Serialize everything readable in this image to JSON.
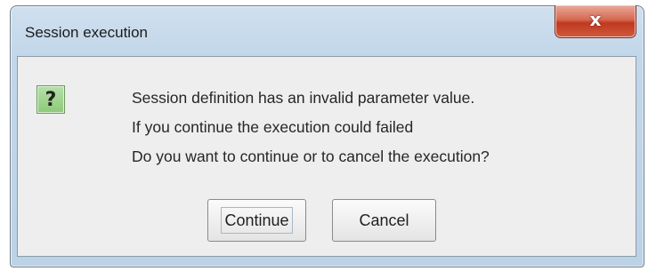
{
  "window": {
    "title": "Session execution",
    "close_glyph": "x"
  },
  "dialog": {
    "icon": "question-icon",
    "icon_glyph": "?",
    "message_lines": [
      "Session definition has an invalid parameter value.",
      "If you continue the execution could failed",
      "Do you want to continue or to cancel the execution?"
    ]
  },
  "buttons": {
    "continue_label": "Continue",
    "cancel_label": "Cancel"
  },
  "colors": {
    "icon_green": "#8cc97a",
    "close_red": "#c0391f"
  }
}
